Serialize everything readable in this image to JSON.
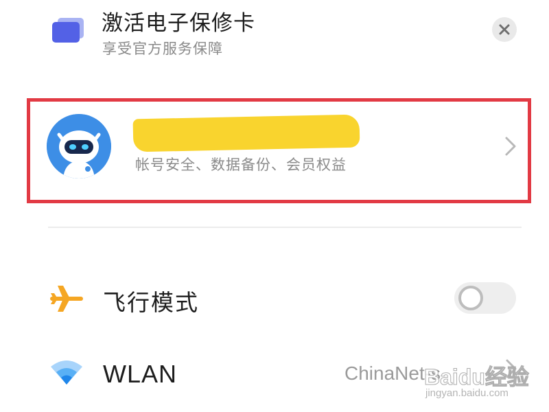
{
  "warranty_card": {
    "title": "激活电子保修卡",
    "subtitle": "享受官方服务保障",
    "icon": "card-icon",
    "close_icon": "close-icon"
  },
  "account": {
    "name": "",
    "name_redacted": true,
    "description": "帐号安全、数据备份、会员权益",
    "avatar_icon": "robot-avatar",
    "chevron_icon": "chevron-right-icon",
    "highlight_color": "#e23a44"
  },
  "settings": [
    {
      "id": "airplane",
      "icon": "airplane-icon",
      "label": "飞行模式",
      "toggle": {
        "on": false
      }
    },
    {
      "id": "wlan",
      "icon": "wifi-icon",
      "label": "WLAN",
      "value": "ChinaNet-s",
      "chevron_icon": "chevron-right-icon"
    }
  ],
  "colors": {
    "accent_blue": "#3d8ee6",
    "airplane_orange": "#f5a623",
    "redaction_yellow": "#f9d42e"
  },
  "watermark": {
    "text": "Baidu经验",
    "url": "jingyan.baidu.com"
  }
}
